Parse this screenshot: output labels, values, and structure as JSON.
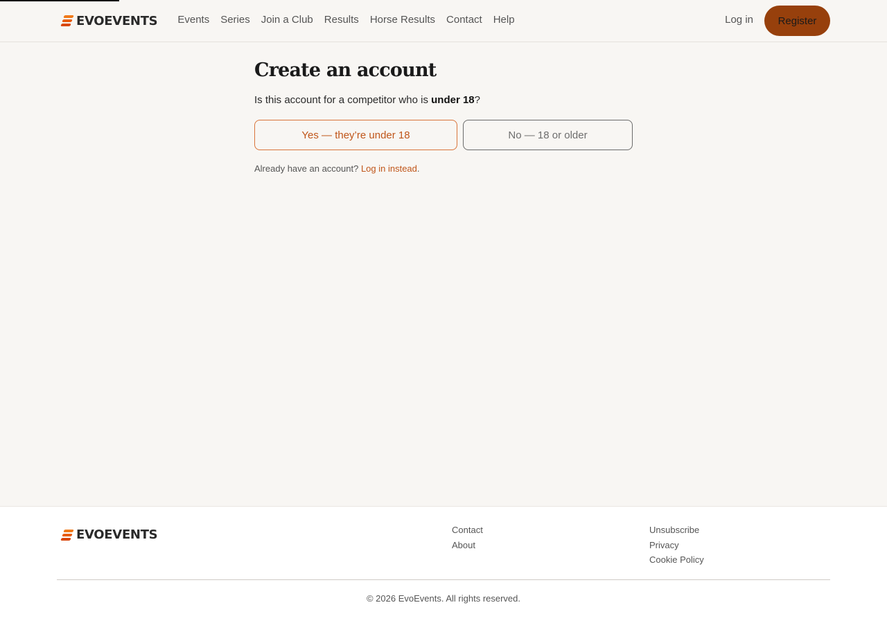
{
  "header": {
    "brand": "EVOEVENTS",
    "nav": [
      "Events",
      "Series",
      "Join a Club",
      "Results",
      "Horse Results",
      "Contact",
      "Help"
    ],
    "login_label": "Log in",
    "register_label": "Register"
  },
  "main": {
    "title": "Create an account",
    "question_prefix": "Is this account for a competitor who is ",
    "question_bold": "under 18",
    "question_suffix": "?",
    "yes_label": "Yes — they’re under 18",
    "no_label": "No — 18 or older",
    "already_text": "Already have an account? ",
    "login_instead": "Log in instead",
    "already_suffix": "."
  },
  "footer": {
    "brand": "EVOEVENTS",
    "col_a": [
      "Contact",
      "About"
    ],
    "col_b": [
      "Unsubscribe",
      "Privacy",
      "Cookie Policy"
    ],
    "copyright": "© 2026 EvoEvents. All rights reserved."
  },
  "colors": {
    "accent": "#c0561a",
    "register_bg": "#97400c",
    "page_bg": "#f8f6f3"
  }
}
